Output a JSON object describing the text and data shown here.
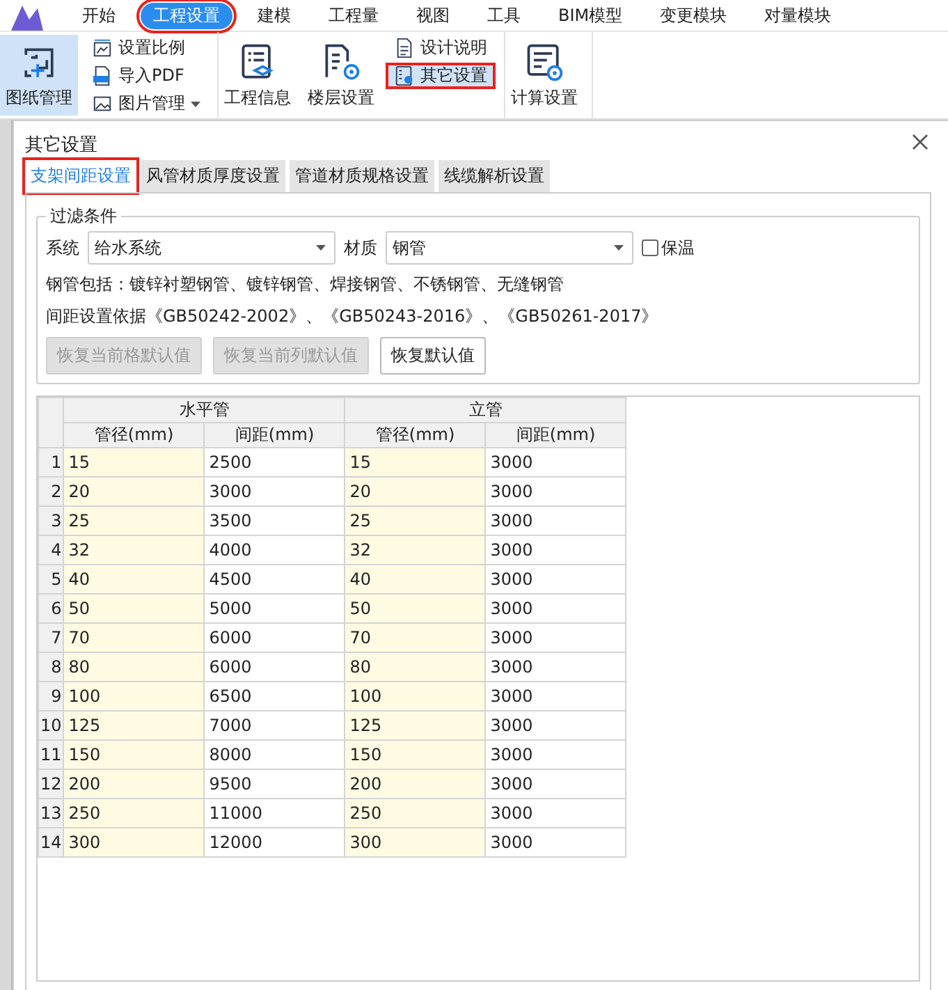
{
  "menu": {
    "items": [
      {
        "label": "开始",
        "selected": false,
        "highlighted": false
      },
      {
        "label": "工程设置",
        "selected": true,
        "highlighted": true
      },
      {
        "label": "建模",
        "selected": false,
        "highlighted": false
      },
      {
        "label": "工程量",
        "selected": false,
        "highlighted": false
      },
      {
        "label": "视图",
        "selected": false,
        "highlighted": false
      },
      {
        "label": "工具",
        "selected": false,
        "highlighted": false
      },
      {
        "label": "BIM模型",
        "selected": false,
        "highlighted": false
      },
      {
        "label": "变更模块",
        "selected": false,
        "highlighted": false
      },
      {
        "label": "对量模块",
        "selected": false,
        "highlighted": false
      }
    ]
  },
  "ribbon": {
    "groups": [
      {
        "items": [
          {
            "kind": "big",
            "label": "图纸管理",
            "selected": true,
            "highlighted": false
          },
          {
            "kind": "small",
            "label": "设置比例",
            "selected": false,
            "highlighted": false
          },
          {
            "kind": "small",
            "label": "导入PDF",
            "selected": false,
            "highlighted": false
          },
          {
            "kind": "small",
            "label": "图片管理",
            "dropdown": true,
            "selected": false,
            "highlighted": false
          }
        ]
      },
      {
        "items": [
          {
            "kind": "big",
            "label": "工程信息",
            "selected": false,
            "highlighted": false
          },
          {
            "kind": "big",
            "label": "楼层设置",
            "selected": false,
            "highlighted": false
          },
          {
            "kind": "small",
            "label": "设计说明",
            "selected": false,
            "highlighted": false
          },
          {
            "kind": "small",
            "label": "其它设置",
            "selected": true,
            "highlighted": true
          }
        ]
      },
      {
        "items": [
          {
            "kind": "big",
            "label": "计算设置",
            "selected": false,
            "highlighted": false
          }
        ]
      }
    ]
  },
  "dialog": {
    "title": "其它设置",
    "tabs": [
      {
        "label": "支架间距设置",
        "selected": true,
        "highlighted": true
      },
      {
        "label": "风管材质厚度设置",
        "selected": false,
        "highlighted": false
      },
      {
        "label": "管道材质规格设置",
        "selected": false,
        "highlighted": false
      },
      {
        "label": "线缆解析设置",
        "selected": false,
        "highlighted": false
      }
    ],
    "filter": {
      "legend": "过滤条件",
      "system": {
        "label": "系统",
        "value": "给水系统"
      },
      "material": {
        "label": "材质",
        "value": "钢管"
      },
      "insulation": {
        "label": "保温",
        "checked": false
      },
      "notes": [
        "钢管包括：镀锌衬塑钢管、镀锌钢管、焊接钢管、不锈钢管、无缝钢管",
        "间距设置依据《GB50242-2002》、《GB50243-2016》、《GB50261-2017》"
      ],
      "buttons": [
        {
          "label": "恢复当前格默认值",
          "disabled": true
        },
        {
          "label": "恢复当前列默认值",
          "disabled": true
        },
        {
          "label": "恢复默认值",
          "disabled": false
        }
      ]
    },
    "table": {
      "groups": [
        {
          "label": "水平管"
        },
        {
          "label": "立管"
        }
      ],
      "columns": [
        {
          "label": "管径(mm)",
          "shaded": true
        },
        {
          "label": "间距(mm)",
          "shaded": false
        },
        {
          "label": "管径(mm)",
          "shaded": true
        },
        {
          "label": "间距(mm)",
          "shaded": false
        }
      ],
      "rows": [
        {
          "index": "1",
          "cells": [
            "15",
            "2500",
            "15",
            "3000"
          ]
        },
        {
          "index": "2",
          "cells": [
            "20",
            "3000",
            "20",
            "3000"
          ]
        },
        {
          "index": "3",
          "cells": [
            "25",
            "3500",
            "25",
            "3000"
          ]
        },
        {
          "index": "4",
          "cells": [
            "32",
            "4000",
            "32",
            "3000"
          ]
        },
        {
          "index": "5",
          "cells": [
            "40",
            "4500",
            "40",
            "3000"
          ]
        },
        {
          "index": "6",
          "cells": [
            "50",
            "5000",
            "50",
            "3000"
          ]
        },
        {
          "index": "7",
          "cells": [
            "70",
            "6000",
            "70",
            "3000"
          ]
        },
        {
          "index": "8",
          "cells": [
            "80",
            "6000",
            "80",
            "3000"
          ]
        },
        {
          "index": "9",
          "cells": [
            "100",
            "6500",
            "100",
            "3000"
          ]
        },
        {
          "index": "10",
          "cells": [
            "125",
            "7000",
            "125",
            "3000"
          ]
        },
        {
          "index": "11",
          "cells": [
            "150",
            "8000",
            "150",
            "3000"
          ]
        },
        {
          "index": "12",
          "cells": [
            "200",
            "9500",
            "200",
            "3000"
          ]
        },
        {
          "index": "13",
          "cells": [
            "250",
            "11000",
            "250",
            "3000"
          ]
        },
        {
          "index": "14",
          "cells": [
            "300",
            "12000",
            "300",
            "3000"
          ]
        }
      ]
    }
  }
}
